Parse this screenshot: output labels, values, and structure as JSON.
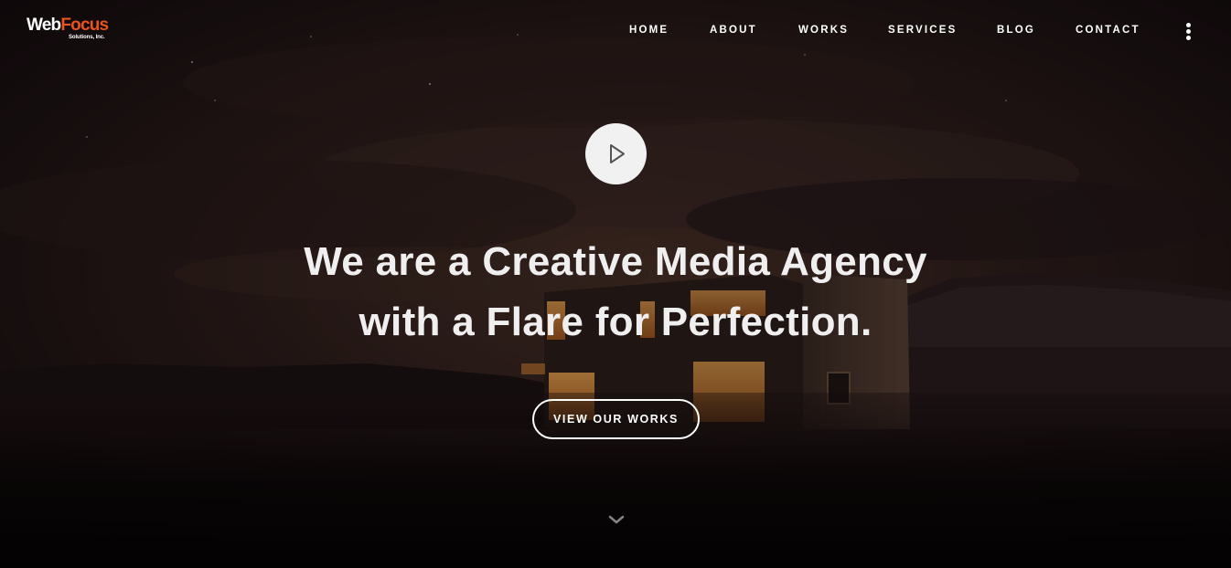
{
  "header": {
    "logo": {
      "main_part1": "Web",
      "main_part2": "Focus",
      "sub": "Solutions, Inc."
    },
    "nav": [
      {
        "label": "HOME"
      },
      {
        "label": "ABOUT"
      },
      {
        "label": "WORKS"
      },
      {
        "label": "SERVICES"
      },
      {
        "label": "BLOG"
      },
      {
        "label": "CONTACT"
      }
    ],
    "menu_icon": "kebab-vertical-icon"
  },
  "hero": {
    "play_icon": "play-icon",
    "headline_line1": "We are a Creative Media Agency",
    "headline_line2": "with a Flare for Perfection.",
    "cta_label": "VIEW OUR WORKS",
    "scroll_icon": "chevron-down-icon"
  },
  "colors": {
    "logo_accent": "#e8531e",
    "text": "#ffffff",
    "background": "#0c0708"
  }
}
